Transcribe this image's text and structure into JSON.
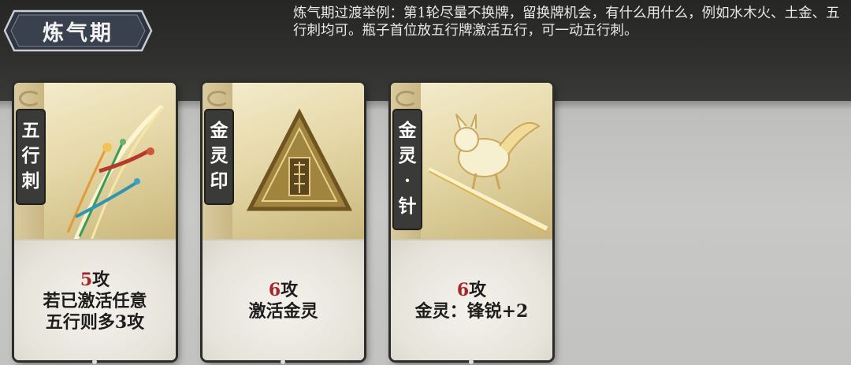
{
  "stage": {
    "title": "炼气期"
  },
  "description": "炼气期过渡举例：第1轮尽量不换牌，留换牌机会，有什么用什么，例如水木火、土金、五行刺均可。瓶子首位放五行牌激活五行，可一动五行刺。",
  "cards": [
    {
      "name_chars": [
        "五",
        "行",
        "刺"
      ],
      "attack_value": "5",
      "attack_unit": "攻",
      "effect_lines": [
        "若已激活任意",
        "五行则多3攻"
      ],
      "art_icon": "five-element-spikes"
    },
    {
      "name_chars": [
        "金",
        "灵",
        "印"
      ],
      "attack_value": "6",
      "attack_unit": "攻",
      "effect_lines": [
        "激活金灵"
      ],
      "art_icon": "golden-triangle-seal"
    },
    {
      "name_chars": [
        "金",
        "灵",
        "·",
        "针"
      ],
      "attack_value": "6",
      "attack_unit": "攻",
      "effect_lines": [
        "金灵：锋锐+2"
      ],
      "art_icon": "golden-spirit-beast"
    }
  ],
  "colors": {
    "attack_number": "#a3272b",
    "name_tag_bg": "#3a3a39"
  }
}
